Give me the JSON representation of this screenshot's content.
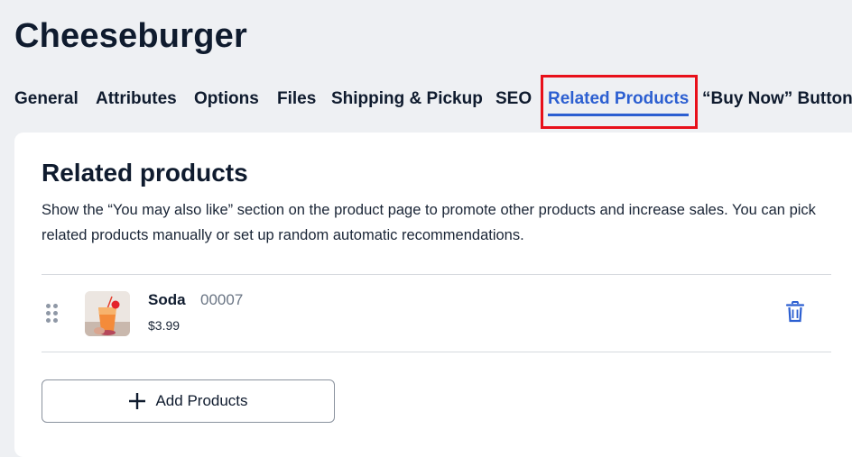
{
  "page": {
    "title": "Cheeseburger"
  },
  "tabs": [
    {
      "label": "General"
    },
    {
      "label": "Attributes"
    },
    {
      "label": "Options"
    },
    {
      "label": "Files"
    },
    {
      "label": "Shipping & Pickup"
    },
    {
      "label": "SEO"
    },
    {
      "label": "Related Products",
      "active": true
    },
    {
      "label": "“Buy Now” Button"
    }
  ],
  "section": {
    "title": "Related products",
    "description": "Show the “You may also like” section on the product page to promote other products and increase sales. You can pick related products manually or set up random automatic recommendations."
  },
  "related_products": [
    {
      "name": "Soda",
      "sku": "00007",
      "price": "$3.99",
      "icon": "soda-thumbnail"
    }
  ],
  "actions": {
    "add_products_label": "Add Products"
  },
  "colors": {
    "accent": "#2c5fd1",
    "highlight": "#e8101a",
    "background": "#eef0f3"
  }
}
